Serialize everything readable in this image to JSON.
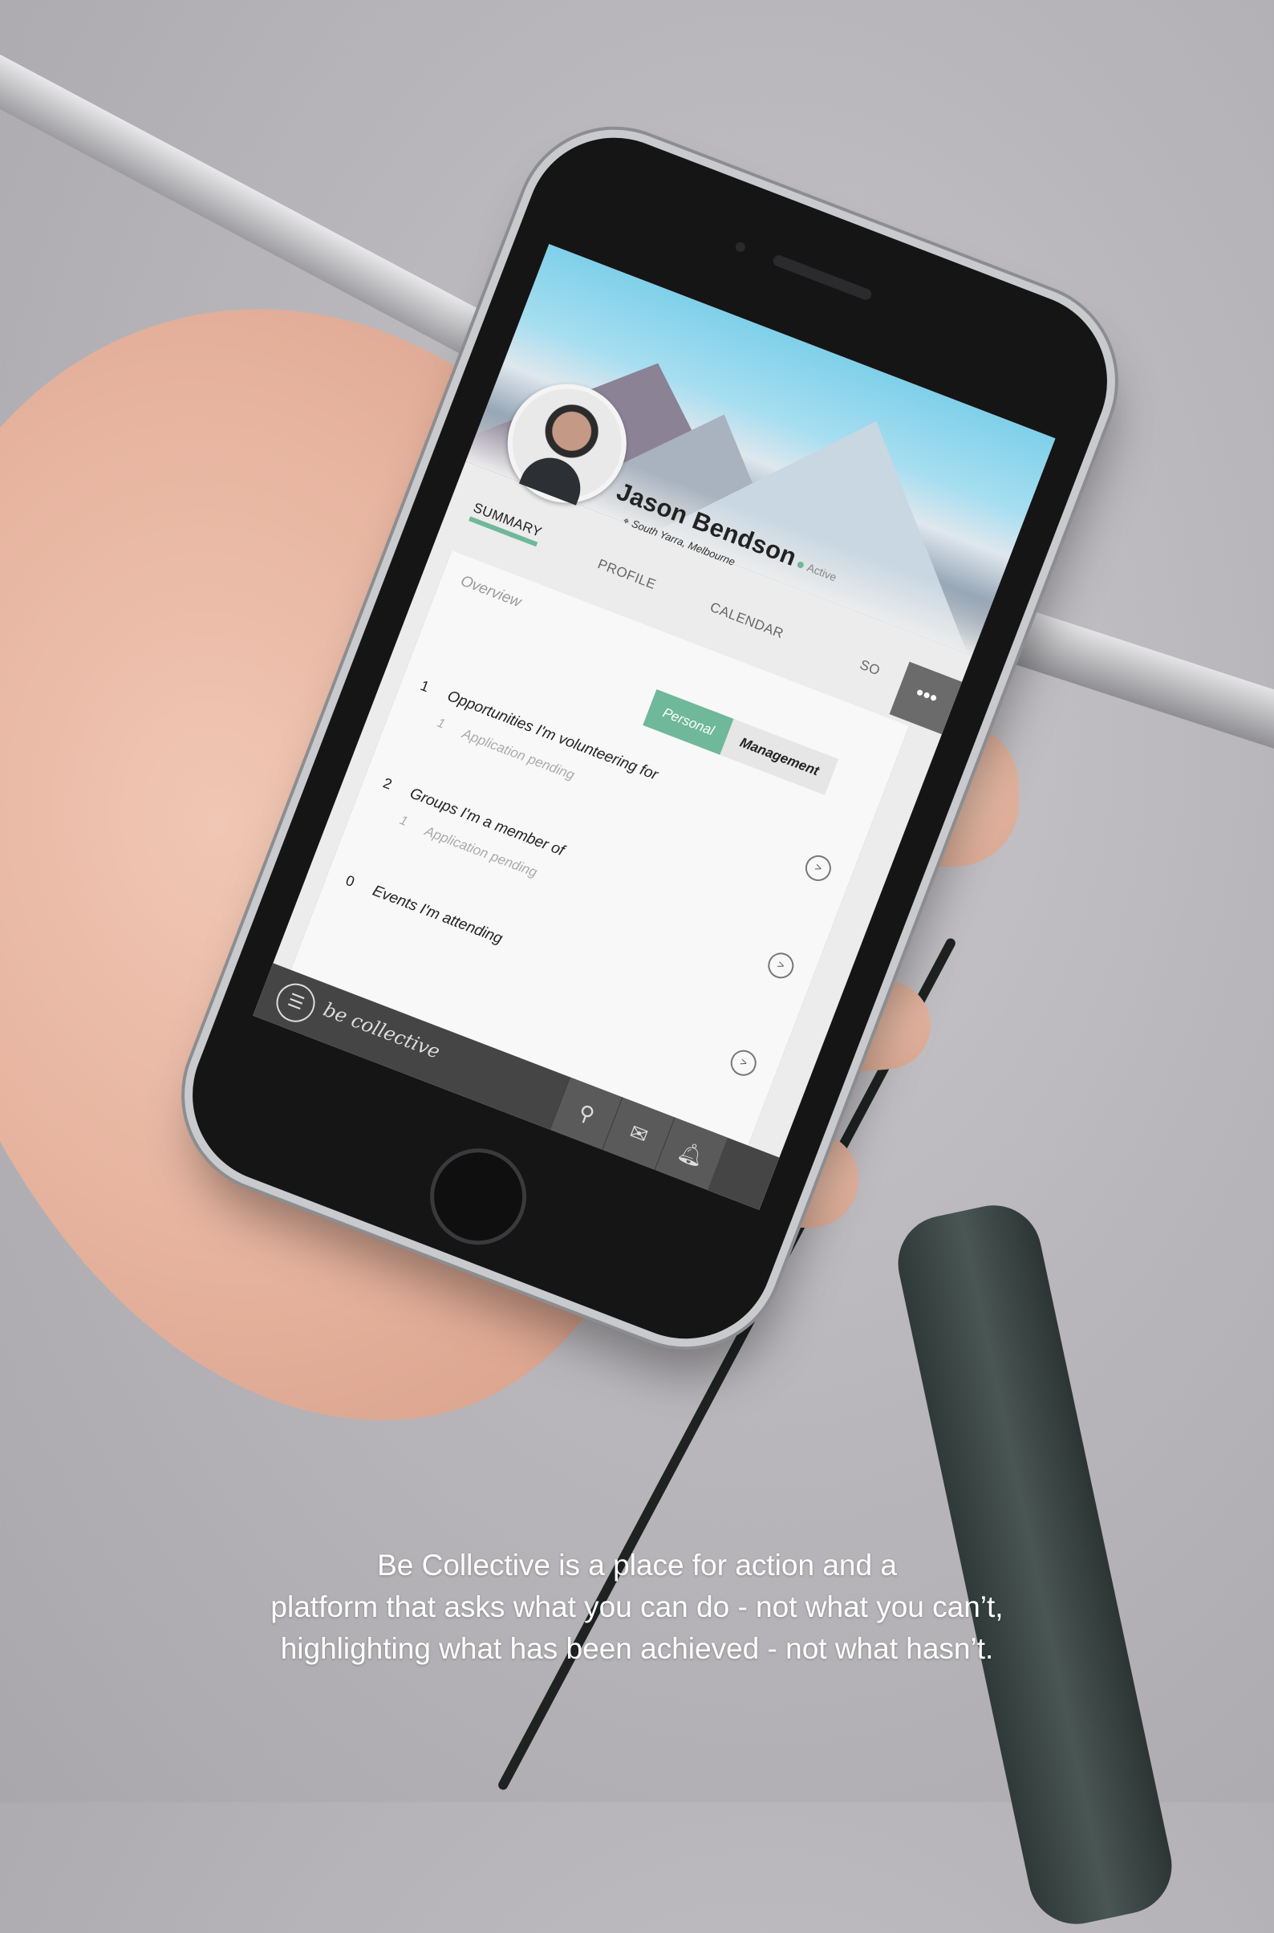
{
  "profile": {
    "name": "Jason Bendson",
    "status": "Active",
    "location": "South Yarra, Melbourne"
  },
  "tabs": [
    "SUMMARY",
    "PROFILE",
    "CALENDAR",
    "SO"
  ],
  "more_label": "•••",
  "overview": {
    "title": "Overview",
    "toggle": {
      "personal": "Personal",
      "management": "Management"
    },
    "rows": [
      {
        "count": "1",
        "label": "Opportunities I'm volunteering for",
        "sub_count": "1",
        "sub_label": "Application pending"
      },
      {
        "count": "2",
        "label": "Groups I'm a member of",
        "sub_count": "1",
        "sub_label": "Application pending"
      },
      {
        "count": "0",
        "label": "Events I'm attending"
      }
    ]
  },
  "bottom_bar": {
    "logo": "be collective",
    "icons": [
      "menu-icon",
      "search-icon",
      "mail-icon",
      "bell-icon"
    ]
  },
  "caption": {
    "line1": "Be Collective is a place for action and a",
    "line2": "platform that asks what you can do - not what you can’t,",
    "line3": "highlighting what has been achieved - not what hasn’t."
  },
  "colors": {
    "accent": "#6fb89a",
    "bar": "#454545"
  }
}
